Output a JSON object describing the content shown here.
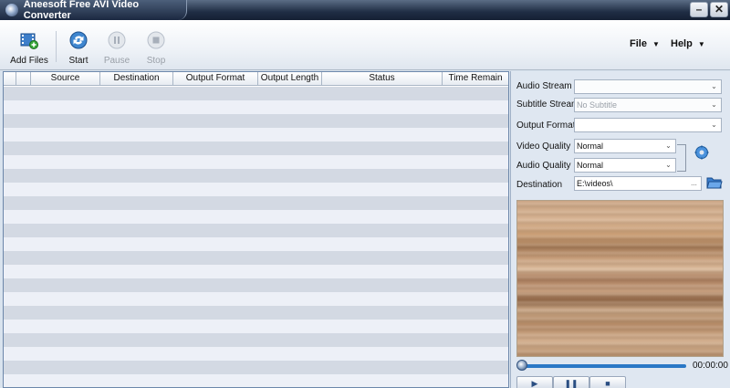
{
  "window": {
    "title": "Aneesoft Free AVI Video Converter"
  },
  "toolbar": {
    "add_files": "Add Files",
    "start": "Start",
    "pause": "Pause",
    "stop": "Stop"
  },
  "menu": {
    "file": "File",
    "help": "Help"
  },
  "table": {
    "columns": [
      "",
      "",
      "Source",
      "Destination",
      "Output Format",
      "Output Length",
      "Status",
      "Time Remain"
    ],
    "rows": []
  },
  "settings": {
    "audio_stream_label": "Audio Stream",
    "audio_stream_value": "",
    "subtitle_stream_label": "Subtitle Stream",
    "subtitle_stream_value": "No Subtitle",
    "output_format_label": "Output Format",
    "output_format_value": "",
    "video_quality_label": "Video Quality",
    "video_quality_value": "Normal",
    "audio_quality_label": "Audio Quality",
    "audio_quality_value": "Normal",
    "destination_label": "Destination",
    "destination_value": "E:\\videos\\",
    "browse_label": "..."
  },
  "player": {
    "time": "00:00:00"
  },
  "colors": {
    "accent": "#2a78c6",
    "titlebar": "#1f2d44"
  }
}
